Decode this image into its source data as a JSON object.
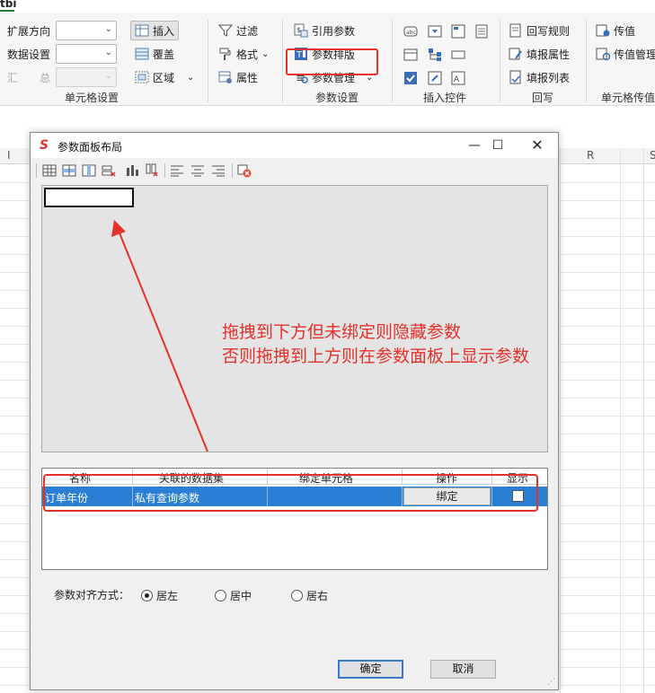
{
  "ribbon_tab": "tbi",
  "ribbon": {
    "cell_settings": {
      "expand_label": "扩展方向",
      "data_label": "数据设置",
      "summary_label": "汇　　总",
      "insert_label": "插入",
      "cover_label": "覆盖",
      "area_label": "区域",
      "group_label": "单元格设置"
    },
    "format_group": {
      "filter_label": "过滤",
      "format_label": "格式",
      "attr_label": "属性"
    },
    "param_settings": {
      "ref_label": "引用参数",
      "layout_label": "参数排版",
      "manage_label": "参数管理",
      "group_label": "参数设置"
    },
    "insert_controls": {
      "group_label": "插入控件"
    },
    "writeback": {
      "rule_label": "回写规则",
      "attr_label": "填报属性",
      "list_label": "填报列表",
      "group_label": "回写"
    },
    "cell_pass": {
      "pass_label": "传值",
      "manage_label": "传值管理",
      "group_label": "单元格传值"
    }
  },
  "sheet": {
    "col_left": "I",
    "col_r": "R",
    "col_s": "S"
  },
  "dialog": {
    "title": "参数面板布局",
    "annotation_line1": "拖拽到下方但未绑定则隐藏参数",
    "annotation_line2": "否则拖拽到上方则在参数面板上显示参数",
    "table": {
      "headers": [
        "名称",
        "关联的数据集",
        "绑定单元格",
        "操作",
        "显示"
      ],
      "rows": [
        {
          "name": "订单年份",
          "dataset": "私有查询参数",
          "bound_cell": "",
          "action": "绑定",
          "show": false
        }
      ]
    },
    "align_label": "参数对齐方式：",
    "align_options": [
      "居左",
      "居中",
      "居右"
    ],
    "align_selected": "居左",
    "ok_label": "确定",
    "cancel_label": "取消"
  },
  "colors": {
    "accent_red": "#e5312c",
    "selection_blue": "#2a7fd4"
  }
}
